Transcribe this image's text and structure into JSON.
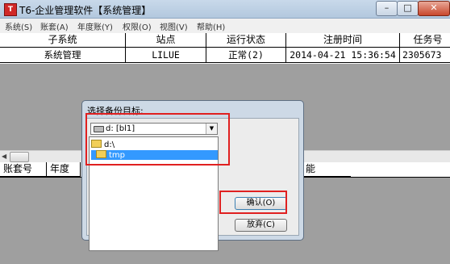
{
  "window": {
    "title": "T6-企业管理软件【系统管理】"
  },
  "menu": [
    {
      "label": "系统(S)"
    },
    {
      "label": "账套(A)"
    },
    {
      "label": "年度账(Y)"
    },
    {
      "label": "权限(O)"
    },
    {
      "label": "视图(V)"
    },
    {
      "label": "帮助(H)"
    }
  ],
  "table1": {
    "headers": [
      "子系统",
      "站点",
      "运行状态",
      "注册时间",
      "任务号"
    ],
    "row": [
      "系统管理",
      "LILUE",
      "正常(2)",
      "2014-04-21 15:36:54",
      "2305673"
    ]
  },
  "table2": {
    "headers": [
      "账套号",
      "年度",
      "能"
    ]
  },
  "dialog": {
    "title": "选择备份目标:",
    "drive": "d: [bl1]",
    "dirs": [
      "d:\\",
      "tmp"
    ],
    "ok_label": "确认(O)",
    "cancel_label": "放弃(C)"
  },
  "colors": {
    "highlight": "#e02020",
    "selection": "#3399ff"
  }
}
